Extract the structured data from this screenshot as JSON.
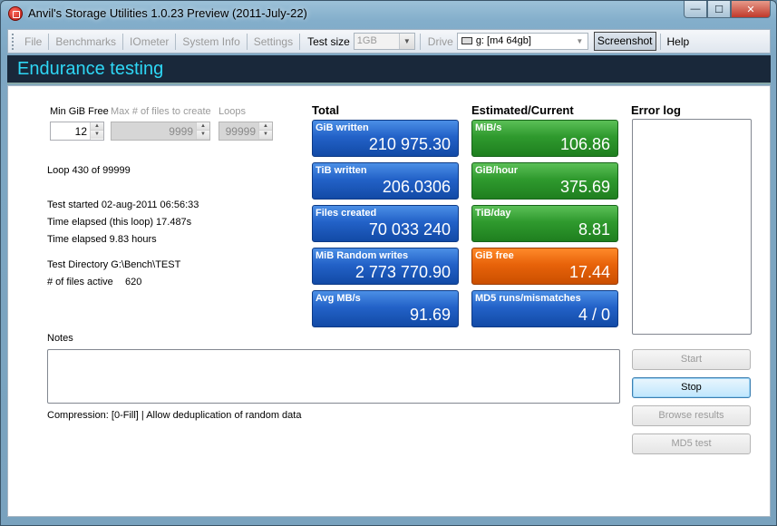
{
  "window": {
    "title": "Anvil's Storage Utilities 1.0.23 Preview (2011-July-22)",
    "controls": {
      "minimize": "—",
      "maximize": "☐",
      "close": "✕"
    }
  },
  "menu": {
    "file": "File",
    "benchmarks": "Benchmarks",
    "iometer": "IOmeter",
    "system_info": "System Info",
    "settings": "Settings",
    "test_size_label": "Test size",
    "test_size_value": "1GB",
    "drive_label": "Drive",
    "drive_value": "g: [m4 64gb]",
    "screenshot": "Screenshot",
    "help": "Help"
  },
  "section": {
    "title": "Endurance testing"
  },
  "params": {
    "min_gib_free_label": "Min GiB Free",
    "min_gib_free_value": "12",
    "max_files_label": "Max # of files to create",
    "max_files_value": "9999",
    "loops_label": "Loops",
    "loops_value": "99999"
  },
  "status": {
    "loop": "Loop 430 of 99999",
    "test_started": "Test started 02-aug-2011 06:56:33",
    "elapsed_loop": "Time elapsed (this loop) 17.487s",
    "elapsed_total": "Time elapsed 9.83 hours",
    "test_directory": "Test Directory G:\\Bench\\TEST",
    "files_active_label": "# of files active",
    "files_active_value": "620"
  },
  "total": {
    "heading": "Total",
    "tiles": [
      {
        "label": "GiB written",
        "value": "210 975.30"
      },
      {
        "label": "TiB written",
        "value": "206.0306"
      },
      {
        "label": "Files created",
        "value": "70 033 240"
      },
      {
        "label": "MiB Random writes",
        "value": "2 773 770.90"
      },
      {
        "label": "Avg MB/s",
        "value": "91.69"
      }
    ]
  },
  "estimated": {
    "heading": "Estimated/Current",
    "tiles": [
      {
        "label": "MiB/s",
        "value": "106.86"
      },
      {
        "label": "GiB/hour",
        "value": "375.69"
      },
      {
        "label": "TiB/day",
        "value": "8.81"
      },
      {
        "label": "GiB free",
        "value": "17.44"
      },
      {
        "label": "MD5 runs/mismatches",
        "value": "4 / 0"
      }
    ]
  },
  "error_log": {
    "heading": "Error log"
  },
  "notes": {
    "label": "Notes",
    "value": ""
  },
  "compression": "Compression: [0-Fill] | Allow deduplication of random data",
  "buttons": {
    "start": "Start",
    "stop": "Stop",
    "browse": "Browse results",
    "md5": "MD5 test"
  },
  "colors": {
    "section_bar": "#19283a",
    "section_title": "#2ed7f5",
    "tile_blue": "#2362c8",
    "tile_green": "#2f9a2e",
    "tile_orange": "#e8630a"
  }
}
